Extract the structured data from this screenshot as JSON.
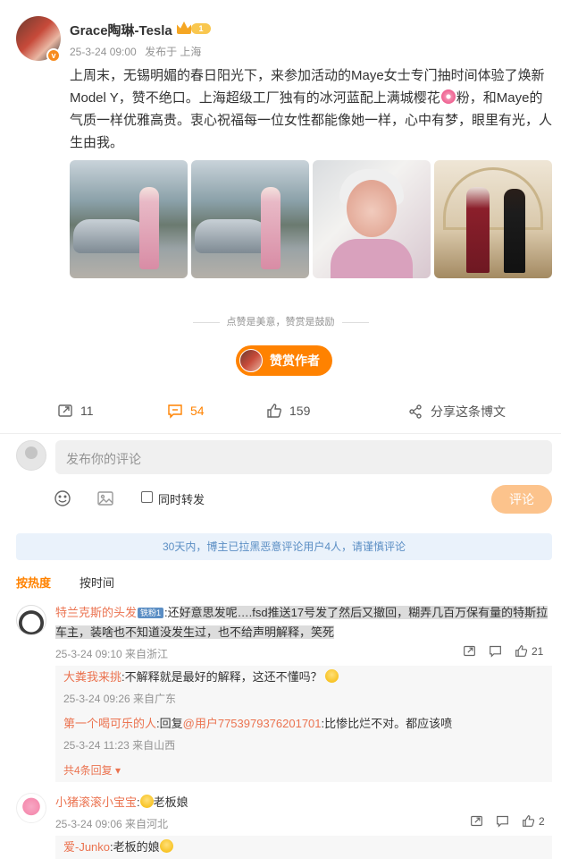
{
  "post": {
    "author": "Grace陶琳-Tesla",
    "verified_badge": "v",
    "level_badge": "1",
    "date": "25-3-24 09:00",
    "source": "发布于 上海",
    "text_part1": "上周末，无锡明媚的春日阳光下，来参加活动的Maye女士专门抽时间体验了焕新Model Y，赞不绝口。上海超级工厂独有的冰河蓝配上满城樱花",
    "text_part2": "粉，和Maye的气质一样优雅高贵。衷心祝福每一位女性都能像她一样，心中有梦，眼里有光，人生由我。",
    "photos": [
      "photo-1",
      "photo-2",
      "photo-3",
      "photo-4"
    ]
  },
  "reward": {
    "tip": "点赞是美意，赞赏是鼓励",
    "button": "赞赏作者"
  },
  "actions": {
    "share_count": "11",
    "comment_count": "54",
    "like_count": "159",
    "share_weibo": "分享这条博文"
  },
  "composer": {
    "placeholder": "发布你的评论",
    "repost_label": "同时转发",
    "submit": "评论"
  },
  "notice": "30天内，博主已拉黑恶意评论用户4人，请谨慎评论",
  "sort": {
    "hot": "按热度",
    "time": "按时间"
  },
  "comments": [
    {
      "user": "特兰克斯的头发",
      "badge": "铁粉1",
      "text_pre": ":还",
      "text_hl": "好意思发呢….fsd推送17号发了然后又撤回，糊弄几百万保有量的特斯拉车主，装啥也不知道没发生过，也不给声明解释，笑死",
      "meta": "25-3-24 09:10 来自浙江",
      "likes": "21",
      "replies": [
        {
          "user": "大粪我来挑",
          "text": ":不解释就是最好的解释，这还不懂吗？",
          "meta": "25-3-24 09:26 来自广东"
        },
        {
          "user": "第一个喝可乐的人",
          "text_a": ":回复",
          "mention": "@用户7753979376201701",
          "text_b": ":比惨比烂不对。都应该喷",
          "meta": "25-3-24 11:23 来自山西"
        }
      ],
      "more": "共4条回复"
    },
    {
      "user": "小猪滚滚小宝宝",
      "text": "老板娘",
      "meta": "25-3-24 09:06 来自河北",
      "likes": "2",
      "replies": [
        {
          "user": "爱-Junko",
          "text": ":老板的娘"
        }
      ]
    }
  ]
}
